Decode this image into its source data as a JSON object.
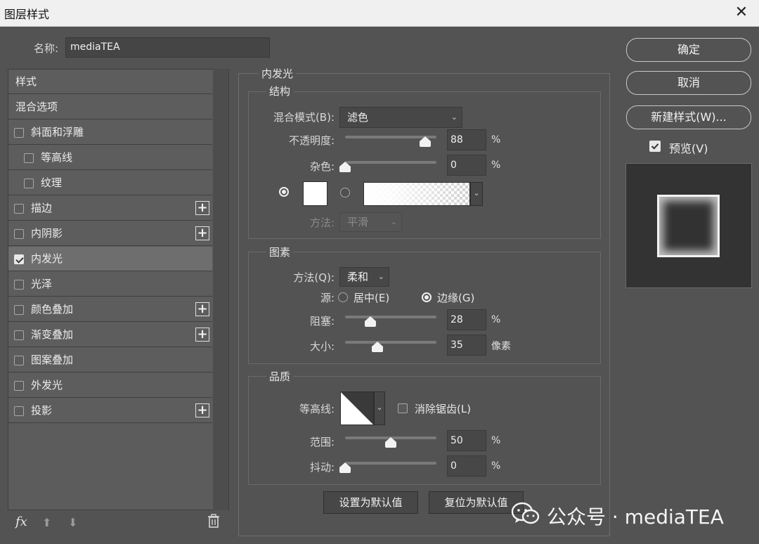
{
  "window": {
    "title": "图层样式",
    "close_glyph": "✕"
  },
  "name_field": {
    "label": "名称:",
    "value": "mediaTEA"
  },
  "style_list": {
    "items": [
      {
        "label": "样式",
        "checkbox": false,
        "checked": false,
        "indent": false,
        "plus": false,
        "selected": false
      },
      {
        "label": "混合选项",
        "checkbox": false,
        "checked": false,
        "indent": false,
        "plus": false,
        "selected": false
      },
      {
        "label": "斜面和浮雕",
        "checkbox": true,
        "checked": false,
        "indent": false,
        "plus": false,
        "selected": false
      },
      {
        "label": "等高线",
        "checkbox": true,
        "checked": false,
        "indent": true,
        "plus": false,
        "selected": false
      },
      {
        "label": "纹理",
        "checkbox": true,
        "checked": false,
        "indent": true,
        "plus": false,
        "selected": false
      },
      {
        "label": "描边",
        "checkbox": true,
        "checked": false,
        "indent": false,
        "plus": true,
        "selected": false
      },
      {
        "label": "内阴影",
        "checkbox": true,
        "checked": false,
        "indent": false,
        "plus": true,
        "selected": false
      },
      {
        "label": "内发光",
        "checkbox": true,
        "checked": true,
        "indent": false,
        "plus": false,
        "selected": true
      },
      {
        "label": "光泽",
        "checkbox": true,
        "checked": false,
        "indent": false,
        "plus": false,
        "selected": false
      },
      {
        "label": "颜色叠加",
        "checkbox": true,
        "checked": false,
        "indent": false,
        "plus": true,
        "selected": false
      },
      {
        "label": "渐变叠加",
        "checkbox": true,
        "checked": false,
        "indent": false,
        "plus": true,
        "selected": false
      },
      {
        "label": "图案叠加",
        "checkbox": true,
        "checked": false,
        "indent": false,
        "plus": false,
        "selected": false
      },
      {
        "label": "外发光",
        "checkbox": true,
        "checked": false,
        "indent": false,
        "plus": false,
        "selected": false
      },
      {
        "label": "投影",
        "checkbox": true,
        "checked": false,
        "indent": false,
        "plus": true,
        "selected": false
      }
    ],
    "plus_glyph": "+",
    "footer": {
      "fx": "fx",
      "up_glyph": "⬆",
      "down_glyph": "⬇",
      "trash_glyph": "🗑"
    }
  },
  "inner_glow": {
    "title": "内发光",
    "structure": {
      "title": "结构",
      "blend_mode_label": "混合模式(B):",
      "blend_mode_value": "滤色",
      "opacity_label": "不透明度:",
      "opacity_value": "88",
      "opacity_level": 88,
      "noise_label": "杂色:",
      "noise_value": "0",
      "noise_level": 0,
      "percent": "%",
      "color_mode": "solid",
      "color": "#ffffff",
      "method_label": "方法:",
      "method_value": "平滑"
    },
    "elements": {
      "title": "图素",
      "technique_label": "方法(Q):",
      "technique_value": "柔和",
      "source_label": "源:",
      "source_center": "居中(E)",
      "source_edge": "边缘(G)",
      "source_selected": "edge",
      "choke_label": "阻塞:",
      "choke_value": "28",
      "choke_level": 28,
      "size_label": "大小:",
      "size_value": "35",
      "size_level": 35,
      "percent": "%",
      "size_unit": "像素"
    },
    "quality": {
      "title": "品质",
      "contour_label": "等高线:",
      "antialias_label": "消除锯齿(L)",
      "antialias_checked": false,
      "range_label": "范围:",
      "range_value": "50",
      "range_level": 50,
      "jitter_label": "抖动:",
      "jitter_value": "0",
      "jitter_level": 0,
      "percent": "%"
    },
    "make_default": "设置为默认值",
    "reset_default": "复位为默认值"
  },
  "right": {
    "ok": "确定",
    "cancel": "取消",
    "new_style": "新建样式(W)...",
    "preview_label": "预览(V)",
    "preview_checked": true
  },
  "watermark": {
    "text": "公众号 · mediaTEA"
  },
  "colors": {
    "background": "#535353",
    "accent": "#f2f2f2",
    "field": "#474747"
  }
}
